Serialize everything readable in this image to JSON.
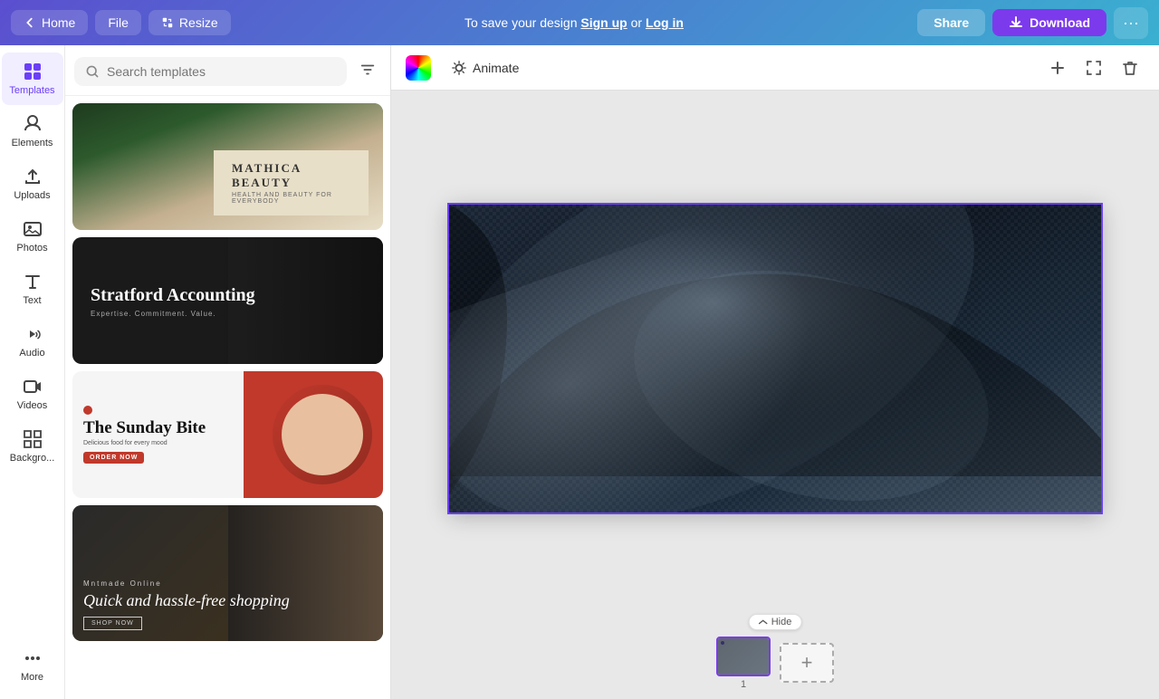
{
  "topbar": {
    "home_label": "Home",
    "file_label": "File",
    "resize_label": "Resize",
    "save_prompt": "To save your design",
    "signup_label": "Sign up",
    "or_label": "or",
    "login_label": "Log in",
    "share_label": "Share",
    "download_label": "Download",
    "more_label": "···"
  },
  "sidebar": {
    "items": [
      {
        "id": "templates",
        "label": "Templates",
        "icon": "templates-icon"
      },
      {
        "id": "elements",
        "label": "Elements",
        "icon": "elements-icon"
      },
      {
        "id": "uploads",
        "label": "Uploads",
        "icon": "uploads-icon"
      },
      {
        "id": "photos",
        "label": "Photos",
        "icon": "photos-icon"
      },
      {
        "id": "text",
        "label": "Text",
        "icon": "text-icon"
      },
      {
        "id": "audio",
        "label": "Audio",
        "icon": "audio-icon"
      },
      {
        "id": "videos",
        "label": "Videos",
        "icon": "videos-icon"
      },
      {
        "id": "backgrounds",
        "label": "Backgro...",
        "icon": "backgrounds-icon"
      },
      {
        "id": "more",
        "label": "More",
        "icon": "more-icon"
      }
    ]
  },
  "search": {
    "placeholder": "Search templates",
    "value": ""
  },
  "templates": [
    {
      "id": "beauty",
      "title": "MATHICA BEAUTY",
      "subtitle": "HEALTH AND BEAUTY FOR EVERYBODY",
      "type": "beauty"
    },
    {
      "id": "accounting",
      "title": "Stratford Accounting",
      "subtitle": "Expertise. Commitment. Value.",
      "type": "accounting"
    },
    {
      "id": "food",
      "title": "The Sunday Bite",
      "subtitle": "Delicious food for every mood",
      "cta": "ORDER NOW",
      "type": "food"
    },
    {
      "id": "fashion",
      "title": "Quick and hassle-free shopping",
      "subtitle": "Mntmade Online",
      "cta": "SHOP NOW",
      "type": "fashion"
    }
  ],
  "canvas": {
    "animate_label": "Animate",
    "page_number": "1"
  },
  "pages_bar": {
    "hide_label": "Hide",
    "add_page_label": "+",
    "page_1_number": "1"
  }
}
